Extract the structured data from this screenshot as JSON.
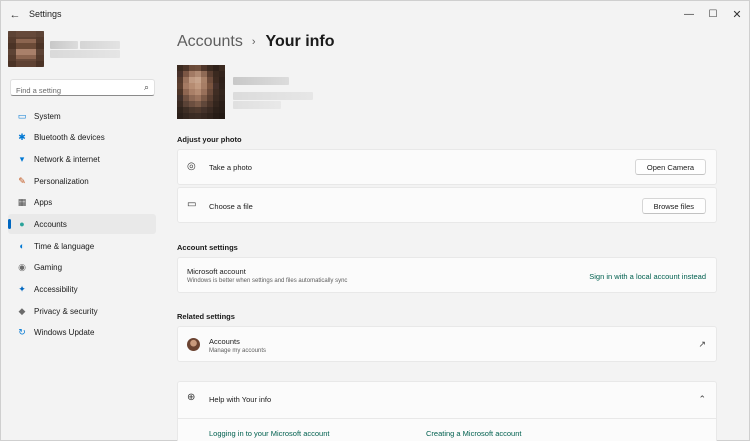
{
  "window": {
    "title": "Settings",
    "back_glyph": "←",
    "minimize_glyph": "—",
    "maximize_glyph": "☐",
    "close_glyph": "✕"
  },
  "sidebar": {
    "search": {
      "placeholder": "Find a setting",
      "value": "",
      "icon": "search-icon"
    },
    "items": [
      {
        "label": "System",
        "icon": "monitor-icon",
        "color": "#0078d4",
        "glyph": "▭"
      },
      {
        "label": "Bluetooth & devices",
        "icon": "bluetooth-icon",
        "color": "#0078d4",
        "glyph": "✱"
      },
      {
        "label": "Network & internet",
        "icon": "wifi-icon",
        "color": "#0078d4",
        "glyph": "▾"
      },
      {
        "label": "Personalization",
        "icon": "brush-icon",
        "color": "#c1541a",
        "glyph": "✎"
      },
      {
        "label": "Apps",
        "icon": "apps-icon",
        "color": "#4a4a4a",
        "glyph": "▦"
      },
      {
        "label": "Accounts",
        "icon": "person-icon",
        "color": "#2aa39a",
        "glyph": "●",
        "active": true
      },
      {
        "label": "Time & language",
        "icon": "globe-clock-icon",
        "color": "#0078d4",
        "glyph": "◐"
      },
      {
        "label": "Gaming",
        "icon": "gamepad-icon",
        "color": "#6b6b6b",
        "glyph": "◉"
      },
      {
        "label": "Accessibility",
        "icon": "accessibility-icon",
        "color": "#0067c0",
        "glyph": "✦"
      },
      {
        "label": "Privacy & security",
        "icon": "shield-icon",
        "color": "#6b6b6b",
        "glyph": "◆"
      },
      {
        "label": "Windows Update",
        "icon": "update-icon",
        "color": "#0078d4",
        "glyph": "↻"
      }
    ]
  },
  "main": {
    "breadcrumb": {
      "parent": "Accounts",
      "separator": "›",
      "current": "Your info"
    },
    "adjust_photo": {
      "title": "Adjust your photo",
      "rows": [
        {
          "label": "Take a photo",
          "icon": "camera-icon",
          "glyph": "◎",
          "button": "Open Camera"
        },
        {
          "label": "Choose a file",
          "icon": "folder-icon",
          "glyph": "▭",
          "button": "Browse files"
        }
      ]
    },
    "account_settings": {
      "title": "Account settings",
      "row": {
        "title": "Microsoft account",
        "subtitle": "Windows is better when settings and files automatically sync",
        "link": "Sign in with a local account instead"
      }
    },
    "related_settings": {
      "title": "Related settings",
      "row": {
        "title": "Accounts",
        "subtitle": "Manage my accounts",
        "icon": "external-link-icon",
        "glyph": "↗"
      }
    },
    "help": {
      "title": "Help with Your info",
      "icon": "globe-icon",
      "glyph": "⊕",
      "chevron": "⌃",
      "links": [
        "Logging in to your Microsoft account",
        "Creating a Microsoft account"
      ]
    }
  },
  "colors": {
    "accent": "#0067c0",
    "link": "#00604f",
    "background": "#f3f3f3",
    "card": "#fbfbfb"
  }
}
